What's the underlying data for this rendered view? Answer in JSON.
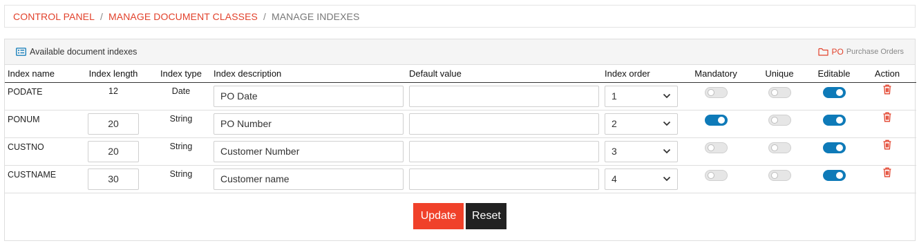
{
  "breadcrumb": {
    "items": [
      "CONTROL PANEL",
      "MANAGE DOCUMENT CLASSES",
      "MANAGE INDEXES"
    ],
    "separator": "/"
  },
  "panel": {
    "title": "Available document indexes",
    "class_code": "PO",
    "class_name": "Purchase Orders"
  },
  "table": {
    "headers": [
      "Index name",
      "Index length",
      "Index type",
      "Index description",
      "Default value",
      "Index order",
      "Mandatory",
      "Unique",
      "Editable",
      "Action"
    ],
    "rows": [
      {
        "name": "PODATE",
        "length": "12",
        "length_editable": false,
        "type": "Date",
        "description": "PO Date",
        "default_value": "",
        "order": "1",
        "mandatory": false,
        "unique": false,
        "editable": true
      },
      {
        "name": "PONUM",
        "length": "20",
        "length_editable": true,
        "type": "String",
        "description": "PO Number",
        "default_value": "",
        "order": "2",
        "mandatory": true,
        "unique": false,
        "editable": true
      },
      {
        "name": "CUSTNO",
        "length": "20",
        "length_editable": true,
        "type": "String",
        "description": "Customer Number",
        "default_value": "",
        "order": "3",
        "mandatory": false,
        "unique": false,
        "editable": true
      },
      {
        "name": "CUSTNAME",
        "length": "30",
        "length_editable": true,
        "type": "String",
        "description": "Customer name",
        "default_value": "",
        "order": "4",
        "mandatory": false,
        "unique": false,
        "editable": true
      }
    ]
  },
  "buttons": {
    "update": "Update",
    "reset": "Reset"
  },
  "colors": {
    "accent": "#e2412b",
    "toggle_on": "#0e7ab8",
    "reset_button": "#222222"
  }
}
